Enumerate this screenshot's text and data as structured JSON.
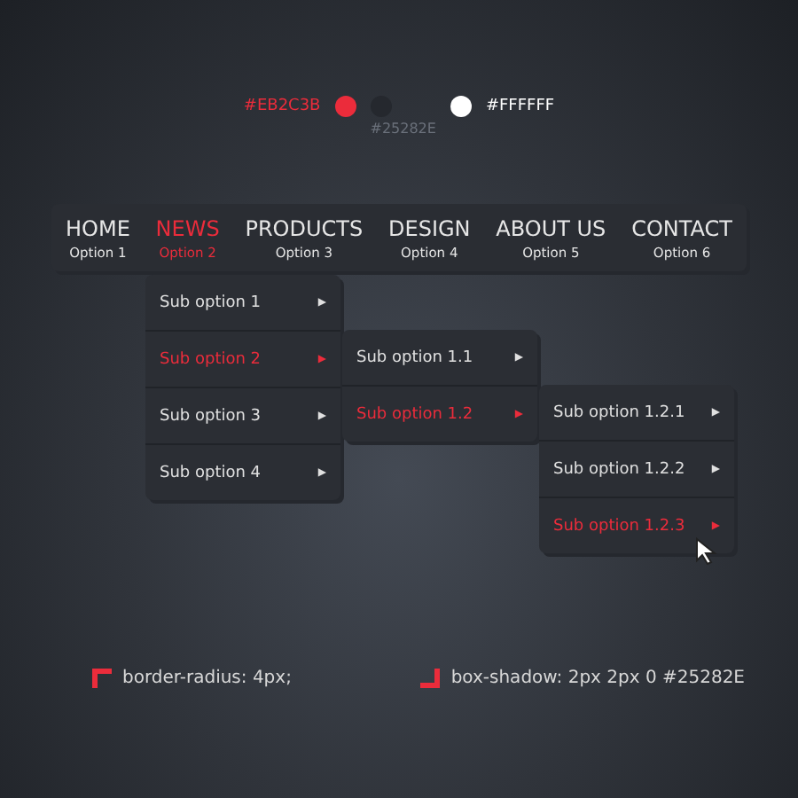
{
  "palette": {
    "left_label": "#EB2C3B",
    "right_label": "#FFFFFF",
    "below_label": "#25282E",
    "swatches": [
      {
        "color": "#eb2c3b"
      },
      {
        "color": "#25282e"
      },
      {
        "color": "#ffffff"
      }
    ]
  },
  "nav": [
    {
      "label": "HOME",
      "sub": "Option 1",
      "selected": false
    },
    {
      "label": "NEWS",
      "sub": "Option 2",
      "selected": true
    },
    {
      "label": "PRODUCTS",
      "sub": "Option 3",
      "selected": false
    },
    {
      "label": "DESIGN",
      "sub": "Option 4",
      "selected": false
    },
    {
      "label": "ABOUT US",
      "sub": "Option 5",
      "selected": false
    },
    {
      "label": "CONTACT",
      "sub": "Option 6",
      "selected": false
    }
  ],
  "submenus": [
    {
      "items": [
        {
          "label": "Sub option 1",
          "arrow": "▶",
          "selected": false
        },
        {
          "label": "Sub option 2",
          "arrow": "▶",
          "selected": true
        },
        {
          "label": "Sub option 3",
          "arrow": "▶",
          "selected": false
        },
        {
          "label": "Sub option 4",
          "arrow": "▶",
          "selected": false
        }
      ]
    },
    {
      "items": [
        {
          "label": "Sub option 1.1",
          "arrow": "▶",
          "selected": false
        },
        {
          "label": "Sub option 1.2",
          "arrow": "▶",
          "selected": true
        }
      ]
    },
    {
      "items": [
        {
          "label": "Sub option 1.2.1",
          "arrow": "▶",
          "selected": false
        },
        {
          "label": "Sub option 1.2.2",
          "arrow": "▶",
          "selected": false
        },
        {
          "label": "Sub option 1.2.3",
          "arrow": "▶",
          "selected": true
        }
      ]
    }
  ],
  "notes": [
    {
      "kind": "radius",
      "text": "border-radius: 4px;"
    },
    {
      "kind": "shadow",
      "text": "box-shadow: 2px 2px 0 #25282E"
    }
  ]
}
